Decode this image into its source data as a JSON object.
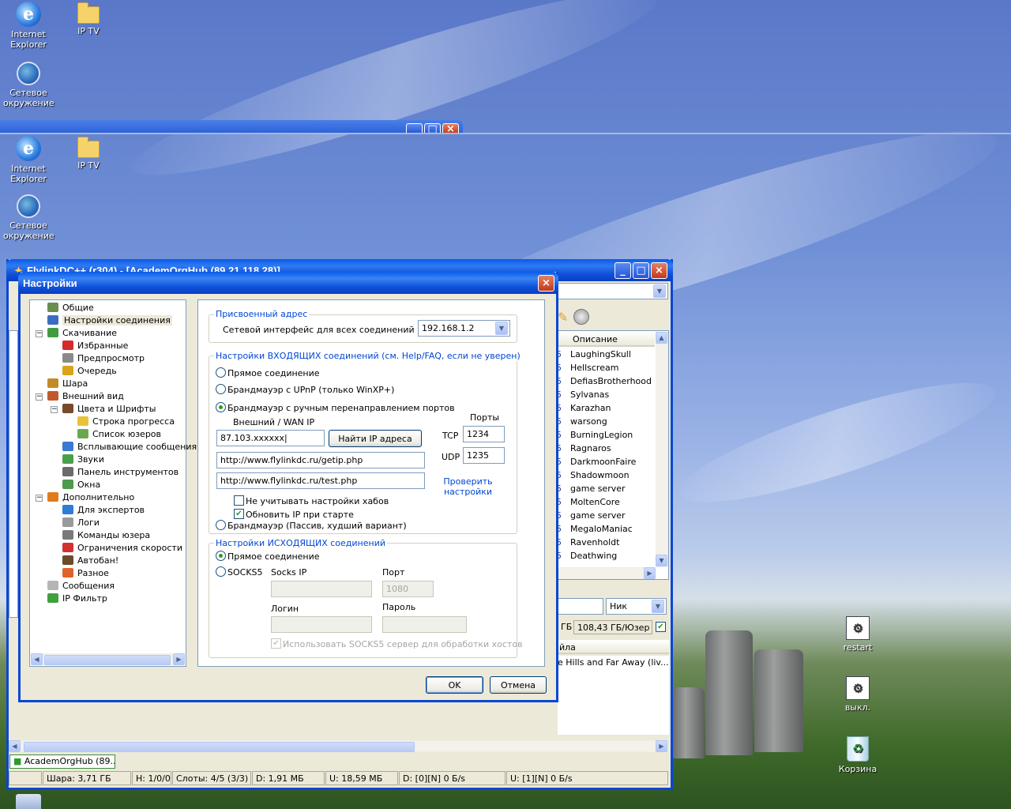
{
  "desktop": {
    "icons_top": [
      {
        "label": "Internet Explorer",
        "glyph": "ie-icon"
      },
      {
        "label": "IP TV",
        "glyph": "folder-icon"
      },
      {
        "label": "Сетевое окружение",
        "glyph": "network-icon"
      }
    ],
    "icons_second": [
      {
        "label": "Internet Explorer"
      },
      {
        "label": "IP TV"
      },
      {
        "label": "Сетевое окружение"
      }
    ],
    "icons_right": [
      {
        "label": "restart"
      },
      {
        "label": "выкл."
      },
      {
        "label": "Корзина"
      }
    ]
  },
  "main_window": {
    "title": "FlylinkDC++ (r304) - [AcademOrgHub (89.21.118.28)]",
    "column_header": "Описание",
    "users": [
      "LaughingSkull",
      "Hellscream",
      "DefiasBrotherhood",
      "Sylvanas",
      "Karazhan",
      "warsong",
      "BurningLegion",
      "Ragnaros",
      "DarkmoonFaire",
      "Shadowmoon",
      "game server",
      "MoltenCore",
      "game server",
      "MegaloManiac",
      "Ravenholdt",
      "Deathwing"
    ],
    "share_size_label": "108,43 ГБ/Юзер",
    "nick_filter": "Ник",
    "search_file_header": "йла",
    "search_result": "e Hills and Far Away (liv...",
    "hub_tab": "AcademOrgHub (89...",
    "status": {
      "share": "Шара: 3,71 ГБ",
      "hubs": "Н: 1/0/0",
      "slots": "Слоты: 4/5 (3/3)",
      "download": "D: 1,91 МБ",
      "upload": "U: 18,59 МБ",
      "dspeed": "D: [0][N] 0 Б/s",
      "uspeed": "U: [1][N] 0 Б/s"
    }
  },
  "dialog": {
    "title": "Настройки",
    "tree": [
      {
        "label": "Общие",
        "level": 1,
        "color": "#6b8e4e"
      },
      {
        "label": "Настройки соединения",
        "level": 1,
        "color": "#3b6ec2",
        "selected": true
      },
      {
        "label": "Скачивание",
        "level": 1,
        "color": "#3f9d3f",
        "expander": "−"
      },
      {
        "label": "Избранные",
        "level": 2,
        "color": "#d42b2b"
      },
      {
        "label": "Предпросмотр",
        "level": 2,
        "color": "#8a8a8a"
      },
      {
        "label": "Очередь",
        "level": 2,
        "color": "#d9a31c"
      },
      {
        "label": "Шара",
        "level": 1,
        "color": "#c48a2a"
      },
      {
        "label": "Внешний вид",
        "level": 1,
        "color": "#c05a2e",
        "expander": "−"
      },
      {
        "label": "Цвета и Шрифты",
        "level": 2,
        "color": "#7a4a2a",
        "expander": "−"
      },
      {
        "label": "Строка прогресса",
        "level": 3,
        "color": "#e8c23a"
      },
      {
        "label": "Список юзеров",
        "level": 3,
        "color": "#6aa84f"
      },
      {
        "label": "Всплывающие сообщения",
        "level": 2,
        "color": "#3a7ad1"
      },
      {
        "label": "Звуки",
        "level": 2,
        "color": "#4aa04a"
      },
      {
        "label": "Панель инструментов",
        "level": 2,
        "color": "#6b6b6b"
      },
      {
        "label": "Окна",
        "level": 2,
        "color": "#4c9a4c"
      },
      {
        "label": "Дополнительно",
        "level": 1,
        "color": "#e07b1d",
        "expander": "−"
      },
      {
        "label": "Для экспертов",
        "level": 2,
        "color": "#2f7bd6"
      },
      {
        "label": "Логи",
        "level": 2,
        "color": "#9a9a9a"
      },
      {
        "label": "Команды юзера",
        "level": 2,
        "color": "#7a7a7a"
      },
      {
        "label": "Ограничения скорости",
        "level": 2,
        "color": "#d43030"
      },
      {
        "label": "Автобан!",
        "level": 2,
        "color": "#6b4a2a"
      },
      {
        "label": "Разное",
        "level": 2,
        "color": "#e0622a"
      },
      {
        "label": "Сообщения",
        "level": 1,
        "color": "#b5b5b5"
      },
      {
        "label": "IP Фильтр",
        "level": 1,
        "color": "#3fa03f"
      }
    ],
    "assigned": {
      "caption": "Присвоенный адрес",
      "iface_label": "Сетевой интерфейс для всех соединений",
      "iface_value": "192.168.1.2"
    },
    "incoming": {
      "caption": "Настройки ВХОДЯЩИХ соединений (см. Help/FAQ, если не уверен)",
      "opt_direct": "Прямое соединение",
      "opt_upnp": "Брандмауэр с UPnP (только WinXP+)",
      "opt_manual": "Брандмауэр с ручным перенаправлением портов",
      "wan_label": "Внешний / WAN IP",
      "ports_label": "Порты",
      "wan_value": "87.103.xxxxxx",
      "find_ip": "Найти IP адреса",
      "tcp_label": "TCP",
      "tcp_value": "1234",
      "udp_label": "UDP",
      "udp_value": "1235",
      "url_getip": "http://www.flylinkdc.ru/getip.php",
      "url_test": "http://www.flylinkdc.ru/test.php",
      "check_link": "Проверить настройки",
      "ignore_hubs": "Не учитывать настройки хабов",
      "update_ip": "Обновить IP при старте",
      "opt_passive": "Брандмауэр (Пассив, худший вариант)"
    },
    "outgoing": {
      "caption": "Настройки ИСХОДЯЩИХ соединений",
      "opt_direct": "Прямое соединение",
      "opt_socks": "SOCKS5",
      "socks_ip": "Socks IP",
      "port": "Порт",
      "port_value": "1080",
      "login": "Логин",
      "password": "Пароль",
      "use_socks": "Использовать SOCKS5 сервер для обработки хостов"
    },
    "ok": "OK",
    "cancel": "Отмена"
  }
}
